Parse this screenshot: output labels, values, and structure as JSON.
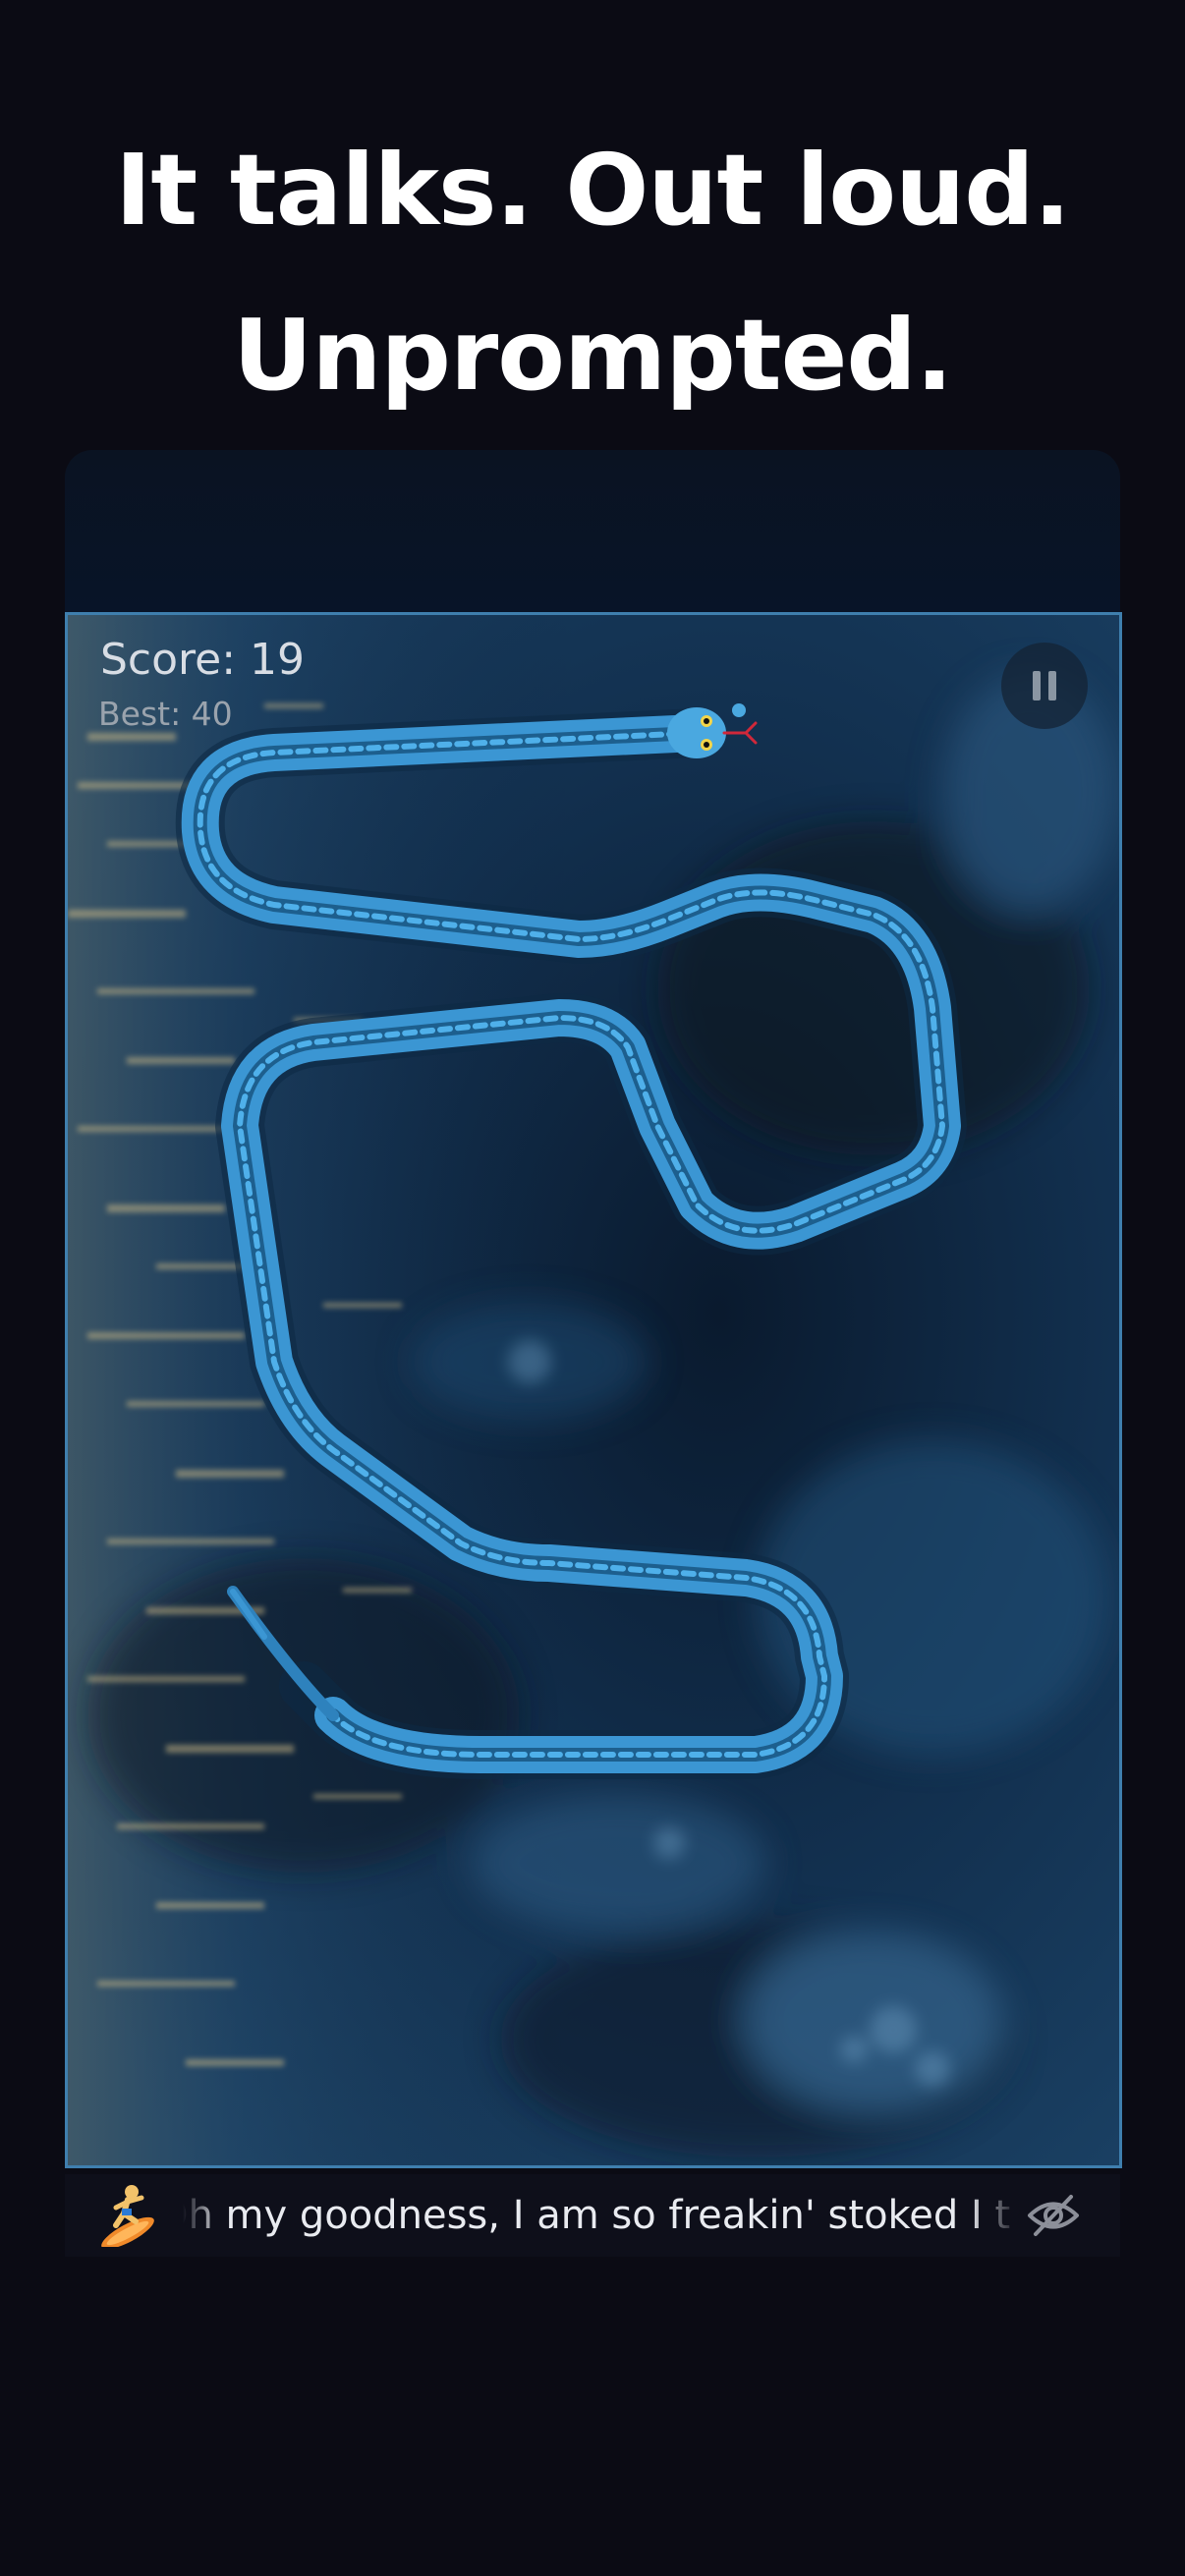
{
  "headline": {
    "line1": "It talks. Out loud.",
    "line2": "Unprompted."
  },
  "game": {
    "score_text": "Score: 19",
    "best_text": "Best: 40",
    "pause_icon": "pause-icon",
    "snake_color": "#4aa8e0",
    "border_color": "#3f7fae"
  },
  "speech": {
    "speaker_icon": "surfer-icon",
    "text": "Oh my goodness, I am so freakin' stoked I t",
    "hide_icon": "eye-slash-icon"
  },
  "colors": {
    "background": "#0b0b14",
    "text": "#ffffff"
  }
}
